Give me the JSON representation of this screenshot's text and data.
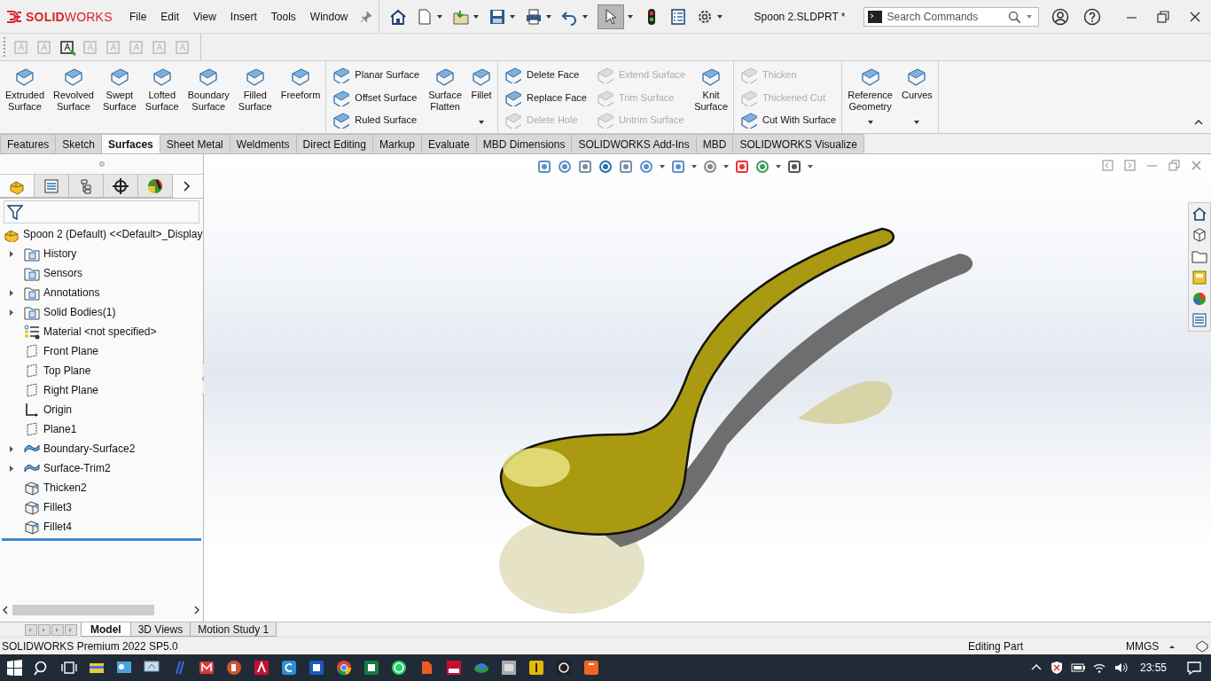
{
  "app_name": "**SOLID**WORKS",
  "menu": [
    "File",
    "Edit",
    "View",
    "Insert",
    "Tools",
    "Window"
  ],
  "document_title": "Spoon 2.SLDPRT *",
  "search": {
    "placeholder": "Search Commands"
  },
  "ribbon": [
    {
      "columns": [
        {
          "kind": "large",
          "items": [
            {
              "label": "Extruded Surface",
              "disabled": false
            }
          ]
        },
        {
          "kind": "large",
          "items": [
            {
              "label": "Revolved Surface",
              "disabled": false
            }
          ]
        },
        {
          "kind": "large",
          "items": [
            {
              "label": "Swept Surface",
              "disabled": false
            }
          ]
        },
        {
          "kind": "large",
          "items": [
            {
              "label": "Lofted Surface",
              "disabled": false
            }
          ]
        },
        {
          "kind": "large",
          "items": [
            {
              "label": "Boundary Surface",
              "disabled": false
            }
          ]
        },
        {
          "kind": "large",
          "items": [
            {
              "label": "Filled Surface",
              "disabled": false
            }
          ]
        },
        {
          "kind": "large",
          "items": [
            {
              "label": "Freeform",
              "disabled": false
            }
          ]
        }
      ]
    },
    {
      "columns": [
        {
          "kind": "stack",
          "items": [
            {
              "label": "Planar Surface",
              "disabled": false
            },
            {
              "label": "Offset Surface",
              "disabled": false
            },
            {
              "label": "Ruled Surface",
              "disabled": false
            }
          ]
        },
        {
          "kind": "large",
          "items": [
            {
              "label": "Surface Flatten",
              "disabled": false
            }
          ]
        },
        {
          "kind": "large",
          "dropdown": true,
          "items": [
            {
              "label": "Fillet",
              "disabled": false
            }
          ]
        }
      ]
    },
    {
      "columns": [
        {
          "kind": "stack",
          "items": [
            {
              "label": "Delete Face",
              "disabled": false
            },
            {
              "label": "Replace Face",
              "disabled": false
            },
            {
              "label": "Delete Hole",
              "disabled": true
            }
          ]
        },
        {
          "kind": "stack",
          "items": [
            {
              "label": "Extend Surface",
              "disabled": true
            },
            {
              "label": "Trim Surface",
              "disabled": true
            },
            {
              "label": "Untrim Surface",
              "disabled": true
            }
          ]
        },
        {
          "kind": "large",
          "items": [
            {
              "label": "Knit Surface",
              "disabled": false
            }
          ]
        }
      ]
    },
    {
      "columns": [
        {
          "kind": "stack",
          "items": [
            {
              "label": "Thicken",
              "disabled": true
            },
            {
              "label": "Thickened Cut",
              "disabled": true
            },
            {
              "label": "Cut With Surface",
              "disabled": false
            }
          ]
        }
      ]
    },
    {
      "columns": [
        {
          "kind": "large",
          "dropdown": true,
          "items": [
            {
              "label": "Reference Geometry",
              "disabled": false
            }
          ]
        },
        {
          "kind": "large",
          "dropdown": true,
          "items": [
            {
              "label": "Curves",
              "disabled": false
            }
          ]
        }
      ]
    }
  ],
  "tabs": [
    {
      "label": "Features",
      "selected": false
    },
    {
      "label": "Sketch",
      "selected": false
    },
    {
      "label": "Surfaces",
      "selected": true
    },
    {
      "label": "Sheet Metal",
      "selected": false
    },
    {
      "label": "Weldments",
      "selected": false
    },
    {
      "label": "Direct Editing",
      "selected": false
    },
    {
      "label": "Markup",
      "selected": false
    },
    {
      "label": "Evaluate",
      "selected": false
    },
    {
      "label": "MBD Dimensions",
      "selected": false
    },
    {
      "label": "SOLIDWORKS Add-Ins",
      "selected": false
    },
    {
      "label": "MBD",
      "selected": false
    },
    {
      "label": "SOLIDWORKS Visualize",
      "selected": false
    }
  ],
  "panel_tabs": [
    {
      "selected": true
    },
    {
      "selected": false
    },
    {
      "selected": false
    },
    {
      "selected": false
    },
    {
      "selected": false
    }
  ],
  "tree": {
    "label": "Spoon 2 (Default) <<Default>_Display",
    "children": [
      {
        "label": "History",
        "kind": "folder",
        "expanded": false
      },
      {
        "label": "Sensors",
        "kind": "folder"
      },
      {
        "label": "Annotations",
        "kind": "folder",
        "expanded": false
      },
      {
        "label": "Solid Bodies(1)",
        "kind": "folder",
        "expanded": false
      },
      {
        "label": "Material <not specified>",
        "kind": "material"
      },
      {
        "label": "Front Plane",
        "kind": "plane"
      },
      {
        "label": "Top Plane",
        "kind": "plane"
      },
      {
        "label": "Right Plane",
        "kind": "plane"
      },
      {
        "label": "Origin",
        "kind": "origin"
      },
      {
        "label": "Plane1",
        "kind": "plane"
      },
      {
        "label": "Boundary-Surface2",
        "kind": "surface",
        "expanded": false
      },
      {
        "label": "Surface-Trim2",
        "kind": "surface",
        "expanded": false
      },
      {
        "label": "Thicken2",
        "kind": "solid"
      },
      {
        "label": "Fillet3",
        "kind": "solid"
      },
      {
        "label": "Fillet4",
        "kind": "solid"
      }
    ]
  },
  "bottom_tabs": [
    {
      "label": "Model",
      "selected": true
    },
    {
      "label": "3D Views",
      "selected": false
    },
    {
      "label": "Motion Study 1",
      "selected": false
    }
  ],
  "status_bar": {
    "product": "SOLIDWORKS Premium 2022 SP5.0",
    "mode": "Editing Part",
    "units": "MMGS"
  },
  "taskbar": {
    "time": "23:55"
  }
}
